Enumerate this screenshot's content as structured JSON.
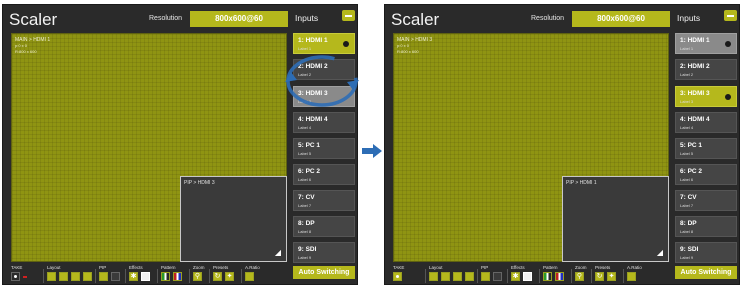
{
  "panels": [
    {
      "title": "Scaler",
      "resolution_label": "Resolution",
      "resolution_value": "800x600@60",
      "main_label": "MAIN > HDMI 1",
      "main_sub1": "p:0 x 0",
      "main_sub2": "R:800 x 600",
      "pip_label": "PIP > HDMI 3",
      "inputs_title": "Inputs",
      "inputs": [
        {
          "name": "1: HDMI 1",
          "label": "Label 1"
        },
        {
          "name": "2: HDMI 2",
          "label": "Label 2"
        },
        {
          "name": "3: HDMI 3",
          "label": "Label 3"
        },
        {
          "name": "4: HDMI 4",
          "label": "Label 4"
        },
        {
          "name": "5: PC 1",
          "label": "Label 5"
        },
        {
          "name": "6: PC 2",
          "label": "Label 6"
        },
        {
          "name": "7: CV",
          "label": "Label 7"
        },
        {
          "name": "8: DP",
          "label": "Label 8"
        },
        {
          "name": "9: SDI",
          "label": "Label 9"
        }
      ],
      "toolbar": {
        "take": "TAKE",
        "layout": "Layout",
        "pip": "PIP",
        "effects": "Effects",
        "pattern": "Pattern",
        "zoom": "Zoom",
        "presets": "Presets",
        "aratio": "A.Ratio"
      },
      "auto_switching": "Auto Switching"
    },
    {
      "title": "Scaler",
      "resolution_label": "Resolution",
      "resolution_value": "800x600@60",
      "main_label": "MAIN > HDMI 3",
      "main_sub1": "p:0 x 0",
      "main_sub2": "R:800 x 600",
      "pip_label": "PIP > HDMI 1",
      "inputs_title": "Inputs",
      "inputs": [
        {
          "name": "1: HDMI 1",
          "label": "Label 1"
        },
        {
          "name": "2: HDMI 2",
          "label": "Label 2"
        },
        {
          "name": "3: HDMI 3",
          "label": "Label 3"
        },
        {
          "name": "4: HDMI 4",
          "label": "Label 4"
        },
        {
          "name": "5: PC 1",
          "label": "Label 5"
        },
        {
          "name": "6: PC 2",
          "label": "Label 6"
        },
        {
          "name": "7: CV",
          "label": "Label 7"
        },
        {
          "name": "8: DP",
          "label": "Label 8"
        },
        {
          "name": "9: SDI",
          "label": "Label 9"
        }
      ],
      "toolbar": {
        "take": "TAKE",
        "layout": "Layout",
        "pip": "PIP",
        "effects": "Effects",
        "pattern": "Pattern",
        "zoom": "Zoom",
        "presets": "Presets",
        "aratio": "A.Ratio"
      },
      "auto_switching": "Auto Switching"
    }
  ],
  "colors": {
    "accent": "#b5b81c",
    "panel_bg": "#2a2a2a",
    "selected_gray": "#8a8a8a",
    "arrow": "#2d6db5"
  }
}
